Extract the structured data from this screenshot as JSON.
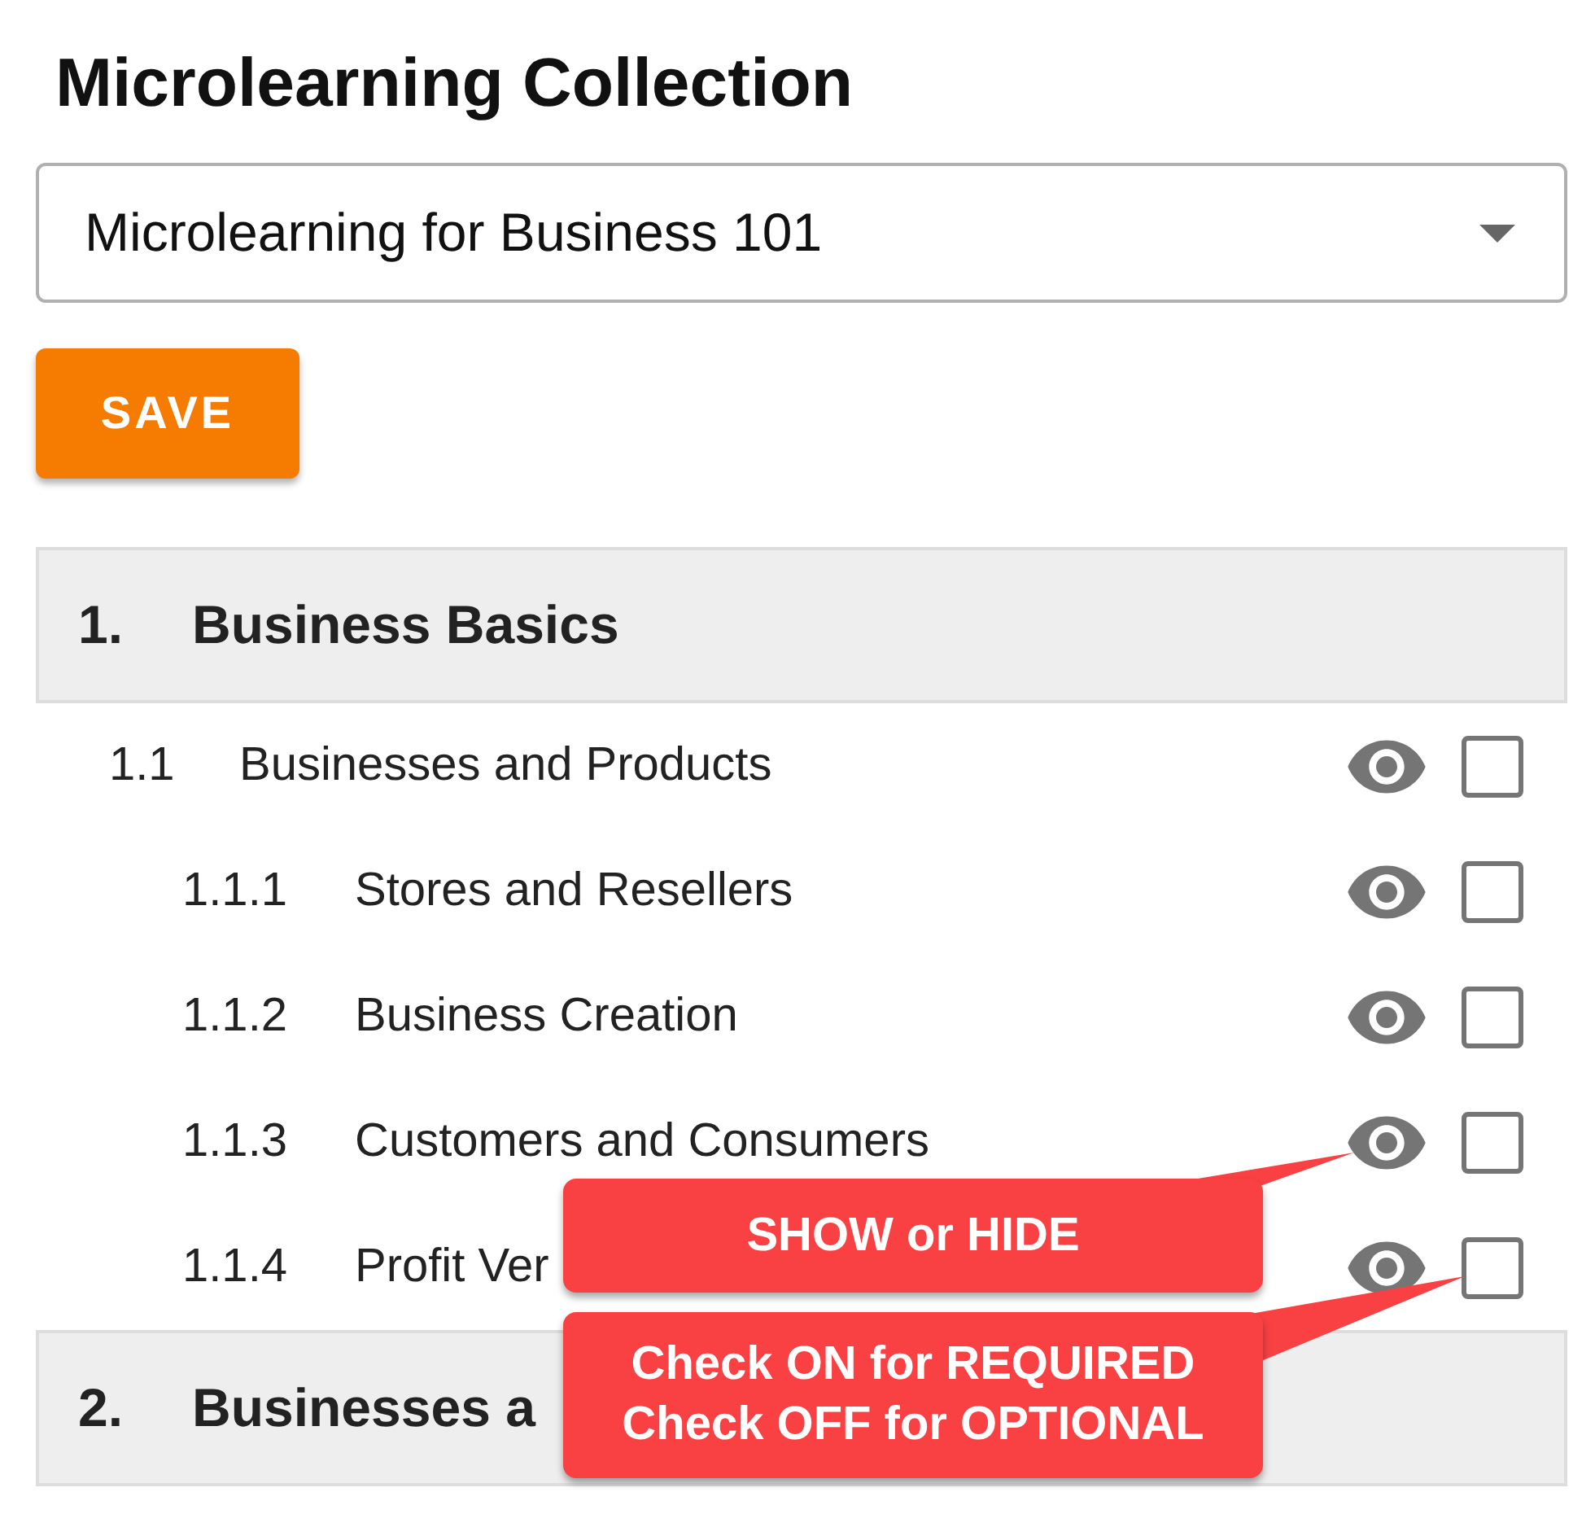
{
  "title": "Microlearning Collection",
  "dropdown": {
    "value": "Microlearning for Business 101"
  },
  "save_button": "SAVE",
  "sections": [
    {
      "number": "1.",
      "title": "Business Basics",
      "children": [
        {
          "number": "1.1",
          "title": "Businesses and Products",
          "visible": true,
          "required": false,
          "children": [
            {
              "number": "1.1.1",
              "title": "Stores and Resellers",
              "visible": true,
              "required": false
            },
            {
              "number": "1.1.2",
              "title": "Business Creation",
              "visible": true,
              "required": false
            },
            {
              "number": "1.1.3",
              "title": "Customers and Consumers",
              "visible": true,
              "required": false
            },
            {
              "number": "1.1.4",
              "title": "Profit Ver",
              "visible": true,
              "required": false
            }
          ]
        }
      ]
    },
    {
      "number": "2.",
      "title": "Businesses a"
    }
  ],
  "callouts": [
    {
      "kind": "eye",
      "lines": [
        "SHOW or HIDE"
      ]
    },
    {
      "kind": "checkbox",
      "lines": [
        "Check ON for REQUIRED",
        "Check OFF for OPTIONAL"
      ]
    }
  ]
}
